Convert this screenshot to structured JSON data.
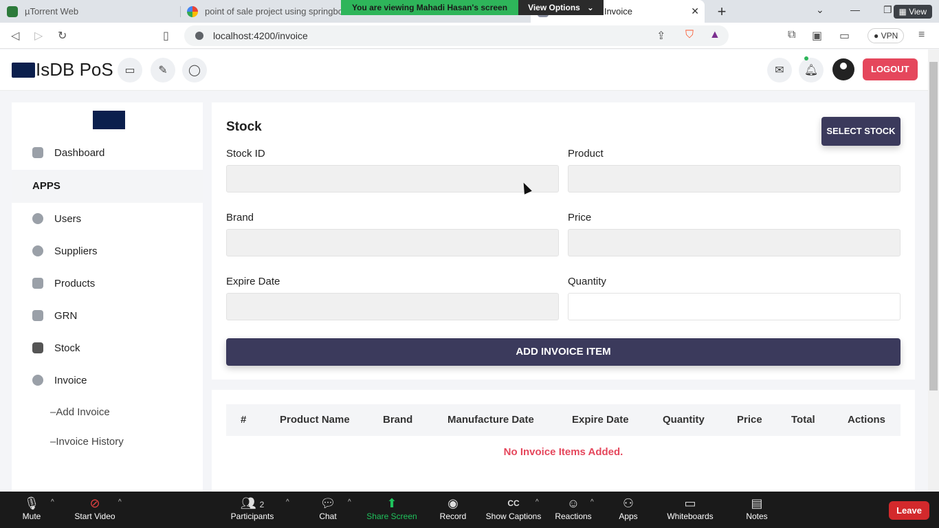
{
  "browser": {
    "tabs": [
      {
        "title": "µTorrent Web"
      },
      {
        "title": "point of sale project using springbo"
      },
      {
        "title": "d Invoice"
      }
    ],
    "zoom_banner_text": "You are viewing Mahadi Hasan's screen",
    "view_options_label": "View Options",
    "view_button": "View",
    "url": "localhost:4200/invoice",
    "vpn_label": "VPN"
  },
  "header": {
    "brand": "IsDB PoS",
    "logout_label": "LOGOUT"
  },
  "sidebar": {
    "items": [
      {
        "label": "Dashboard",
        "icon": "dashboard-icon"
      },
      {
        "label": "Users",
        "icon": "users-icon"
      },
      {
        "label": "Suppliers",
        "icon": "suppliers-icon"
      },
      {
        "label": "Products",
        "icon": "box-icon"
      },
      {
        "label": "GRN",
        "icon": "grn-icon"
      },
      {
        "label": "Stock",
        "icon": "layers-icon"
      },
      {
        "label": "Invoice",
        "icon": "dollar-icon"
      }
    ],
    "section_label": "APPS",
    "sub_items": [
      {
        "label": "Add Invoice"
      },
      {
        "label": "Invoice History"
      }
    ]
  },
  "form": {
    "title": "Stock",
    "select_stock_label": "SELECT STOCK",
    "fields": {
      "stock_id": {
        "label": "Stock ID",
        "value": ""
      },
      "product": {
        "label": "Product",
        "value": ""
      },
      "brand": {
        "label": "Brand",
        "value": ""
      },
      "price": {
        "label": "Price",
        "value": ""
      },
      "expire_date": {
        "label": "Expire Date",
        "value": ""
      },
      "quantity": {
        "label": "Quantity",
        "value": ""
      }
    },
    "add_item_label": "ADD INVOICE ITEM"
  },
  "table": {
    "columns": [
      "#",
      "Product Name",
      "Brand",
      "Manufacture Date",
      "Expire Date",
      "Quantity",
      "Price",
      "Total",
      "Actions"
    ],
    "empty_message": "No Invoice Items Added."
  },
  "zoom": {
    "controls": [
      {
        "label": "Mute",
        "icon": "microphone-icon"
      },
      {
        "label": "Start Video",
        "icon": "video-off-icon"
      },
      {
        "label": "Participants",
        "icon": "participants-icon",
        "count": "2"
      },
      {
        "label": "Chat",
        "icon": "chat-icon"
      },
      {
        "label": "Share Screen",
        "icon": "share-screen-icon"
      },
      {
        "label": "Record",
        "icon": "record-icon"
      },
      {
        "label": "Show Captions",
        "icon": "captions-icon"
      },
      {
        "label": "Reactions",
        "icon": "reactions-icon"
      },
      {
        "label": "Apps",
        "icon": "apps-icon"
      },
      {
        "label": "Whiteboards",
        "icon": "whiteboard-icon"
      },
      {
        "label": "Notes",
        "icon": "notes-icon"
      }
    ],
    "leave_label": "Leave"
  }
}
